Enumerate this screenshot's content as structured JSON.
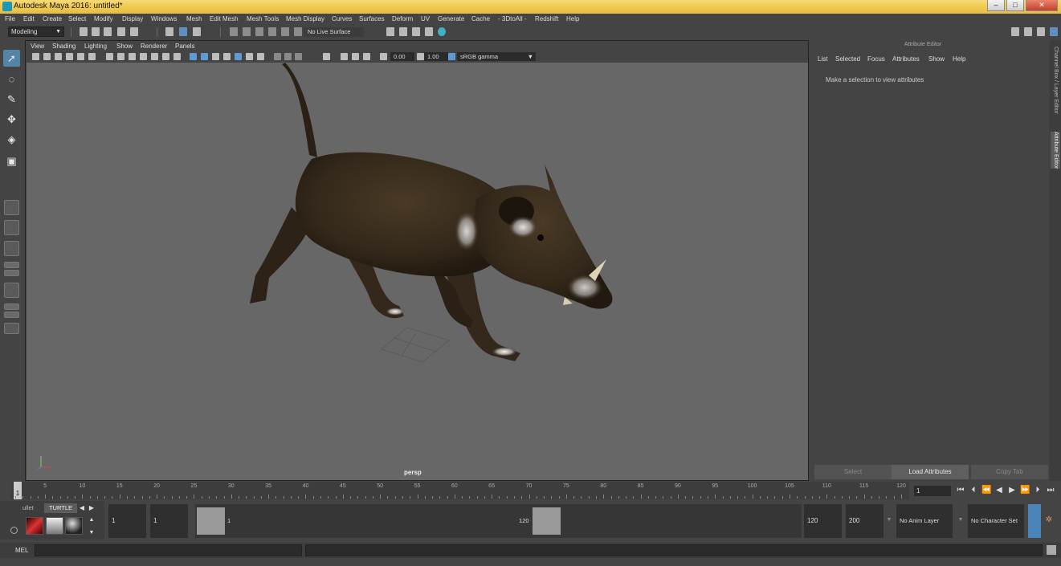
{
  "window": {
    "title": "Autodesk Maya 2016: untitled*",
    "buttons": [
      "–",
      "□",
      "✕"
    ]
  },
  "menubar": [
    "File",
    "Edit",
    "Create",
    "Select",
    "Modify",
    "Display",
    "Windows",
    "Mesh",
    "Edit Mesh",
    "Mesh Tools",
    "Mesh Display",
    "Curves",
    "Surfaces",
    "Deform",
    "UV",
    "Generate",
    "Cache",
    "- 3DtoAll -",
    "Redshift",
    "Help"
  ],
  "statusline": {
    "mode": "Modeling",
    "live_surface": "No Live Surface"
  },
  "viewport": {
    "menu": [
      "View",
      "Shading",
      "Lighting",
      "Show",
      "Renderer",
      "Panels"
    ],
    "exposure": "0.00",
    "gamma": "1.00",
    "color_space": "sRGB gamma",
    "camera": "persp"
  },
  "attribute_editor": {
    "title": "Attribute Editor",
    "menu": [
      "List",
      "Selected",
      "Focus",
      "Attributes",
      "Show",
      "Help"
    ],
    "message": "Make a selection to view attributes",
    "buttons": [
      "Select",
      "Load Attributes",
      "Copy Tab"
    ],
    "side_tabs": [
      "Channel Box / Layer Editor",
      "Attribute Editor"
    ]
  },
  "timeline": {
    "ticks": [
      "5",
      "10",
      "15",
      "20",
      "25",
      "30",
      "35",
      "40",
      "45",
      "50",
      "55",
      "60",
      "65",
      "70",
      "75",
      "80",
      "85",
      "90",
      "95",
      "100",
      "105",
      "110",
      "115",
      "120"
    ],
    "current": "1",
    "current_field": "1"
  },
  "shelf": {
    "tabs": [
      "ullet",
      "TURTLE"
    ]
  },
  "range": {
    "start": "1",
    "anim_start": "1",
    "handle_start": "1",
    "handle_end": "120",
    "end": "120",
    "anim_end": "200",
    "anim_layer": "No Anim Layer",
    "character_set": "No Character Set"
  },
  "cmdline": {
    "label": "MEL"
  },
  "colors": {
    "titlebar": "#f2cd55",
    "accent": "#5285a6",
    "viewport_bg": "#676767"
  },
  "icons": [
    "select-tool-icon",
    "lasso-tool-icon",
    "paint-tool-icon",
    "move-tool-icon",
    "rotate-tool-icon",
    "scale-tool-icon",
    "maya-logo-icon"
  ]
}
